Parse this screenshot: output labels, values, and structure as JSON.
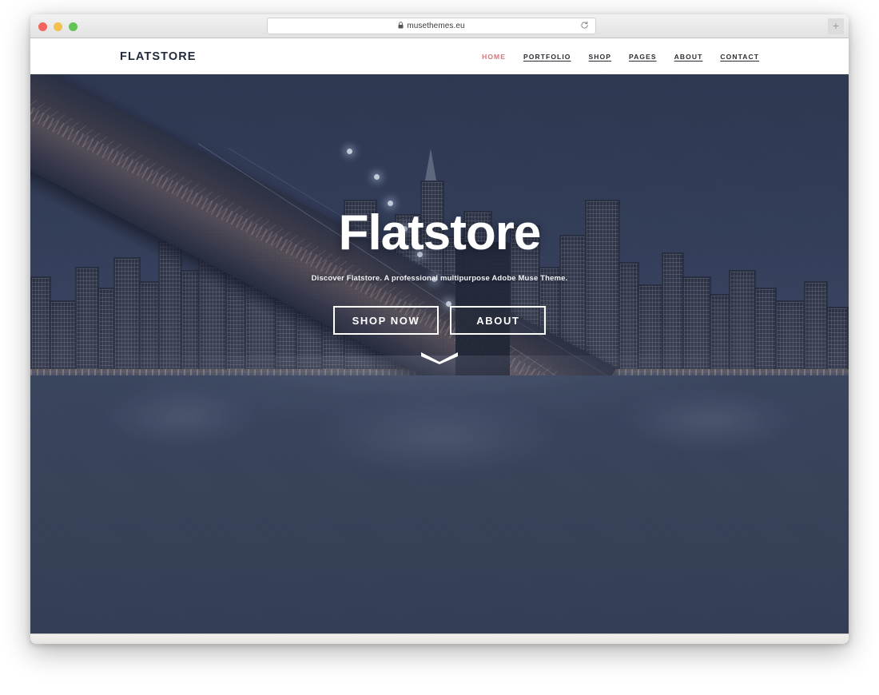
{
  "browser": {
    "traffic_lights": [
      {
        "name": "close",
        "color": "#f1655d"
      },
      {
        "name": "minimize",
        "color": "#f4bf4f"
      },
      {
        "name": "zoom",
        "color": "#61c454"
      }
    ],
    "address_bar": {
      "url": "musethemes.eu",
      "lock_glyph": "A",
      "secure": true,
      "reload_glyph": "↻"
    },
    "new_tab_label": "+"
  },
  "site": {
    "brand": "FLATSTORE",
    "nav": [
      {
        "label": "HOME",
        "active": true
      },
      {
        "label": "PORTFOLIO",
        "active": false
      },
      {
        "label": "SHOP",
        "active": false
      },
      {
        "label": "PAGES",
        "active": false
      },
      {
        "label": "ABOUT",
        "active": false
      },
      {
        "label": "CONTACT",
        "active": false
      }
    ],
    "nav_active_color": "#d4737c",
    "nav_color": "#2b2b33"
  },
  "hero": {
    "title": "Flatstore",
    "subtitle": "Discover Flatstore. A professional multipurpose Adobe Muse Theme.",
    "buttons": [
      {
        "label": "SHOP NOW"
      },
      {
        "label": "ABOUT"
      }
    ],
    "scroll_hint": "chevron-down",
    "background_scene": "night city skyline with suspension bridge over water",
    "overlay_color": "#36415a"
  }
}
